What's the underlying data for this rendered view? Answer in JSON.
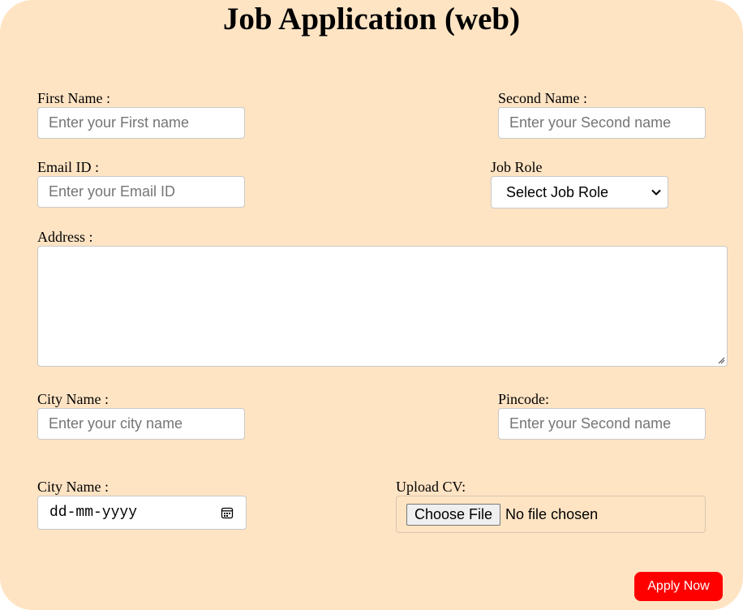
{
  "form": {
    "title": "Job Application (web)",
    "first_name": {
      "label": "First Name :",
      "placeholder": "Enter your First name",
      "value": ""
    },
    "second_name": {
      "label": "Second Name :",
      "placeholder": "Enter your Second name",
      "value": ""
    },
    "email": {
      "label": "Email ID :",
      "placeholder": "Enter your Email ID",
      "value": ""
    },
    "job_role": {
      "label": "Job Role",
      "selected": "Select Job Role"
    },
    "address": {
      "label": "Address :",
      "value": ""
    },
    "city": {
      "label": "City Name :",
      "placeholder": "Enter your city name",
      "value": ""
    },
    "pincode": {
      "label": "Pincode:",
      "placeholder": "Enter your Second name",
      "value": ""
    },
    "date": {
      "label": "City Name :",
      "placeholder": "dd-mm-yyyy"
    },
    "upload": {
      "label": "Upload CV:",
      "button_label": "Choose File",
      "status": "No file chosen"
    },
    "apply_label": "Apply Now"
  },
  "icons": {
    "dropdown": "chevron-down-icon",
    "calendar": "calendar-icon",
    "resize": "resize-grip-icon"
  },
  "colors": {
    "background": "#ffe4c4",
    "apply_button": "#ff0000",
    "apply_text": "#ffffff"
  }
}
